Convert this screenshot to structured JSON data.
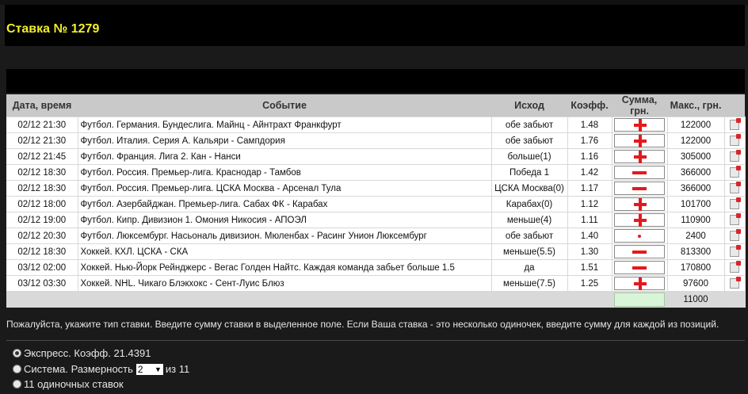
{
  "title": "Ставка № 1279",
  "table": {
    "headers": {
      "date": "Дата, время",
      "event": "Событие",
      "outcome": "Исход",
      "coef": "Коэфф.",
      "sum": "Сумма, грн.",
      "max": "Макс., грн."
    },
    "rows": [
      {
        "date": "02/12 21:30",
        "event": "Футбол. Германия. Бундеслига. Майнц - Айнтрахт Франкфурт",
        "outcome": "обе забьют",
        "coef": "1.48",
        "mark": "plus",
        "max": "122000"
      },
      {
        "date": "02/12 21:30",
        "event": "Футбол. Италия. Серия А. Кальяри - Сампдория",
        "outcome": "обе забьют",
        "coef": "1.76",
        "mark": "plus",
        "max": "122000"
      },
      {
        "date": "02/12 21:45",
        "event": "Футбол. Франция. Лига 2. Кан - Нанси",
        "outcome": "больше(1)",
        "coef": "1.16",
        "mark": "plus",
        "max": "305000"
      },
      {
        "date": "02/12 18:30",
        "event": "Футбол. Россия. Премьер-лига. Краснодар - Тамбов",
        "outcome": "Победа 1",
        "coef": "1.42",
        "mark": "minus",
        "max": "366000"
      },
      {
        "date": "02/12 18:30",
        "event": "Футбол. Россия. Премьер-лига. ЦСКА Москва - Арсенал Тула",
        "outcome": "ЦСКА Москва(0)",
        "coef": "1.17",
        "mark": "minus",
        "max": "366000"
      },
      {
        "date": "02/12 18:00",
        "event": "Футбол. Азербайджан. Премьер-лига. Сабах ФК - Карабах",
        "outcome": "Карабах(0)",
        "coef": "1.12",
        "mark": "plus",
        "max": "101700"
      },
      {
        "date": "02/12 19:00",
        "event": "Футбол. Кипр. Дивизион 1. Омония Никосия - АПОЭЛ",
        "outcome": "меньше(4)",
        "coef": "1.11",
        "mark": "plus",
        "max": "110900"
      },
      {
        "date": "02/12 20:30",
        "event": "Футбол. Люксембург. Насьональ дивизион. Мюленбах - Расинг Унион Люксембург",
        "outcome": "обе забьют",
        "coef": "1.40",
        "mark": "dot",
        "max": "2400"
      },
      {
        "date": "02/12 18:30",
        "event": "Хоккей. КХЛ. ЦСКА - СКА",
        "outcome": "меньше(5.5)",
        "coef": "1.30",
        "mark": "minus",
        "max": "813300"
      },
      {
        "date": "03/12 02:00",
        "event": "Хоккей. Нью-Йорк Рейнджерс - Вегас Голден Найтс. Каждая команда забьет больше 1.5",
        "outcome": "да",
        "coef": "1.51",
        "mark": "minus",
        "max": "170800"
      },
      {
        "date": "03/12 03:30",
        "event": "Хоккей. NHL. Чикаго Блэкхокс - Сент-Луис Блюз",
        "outcome": "меньше(7.5)",
        "coef": "1.25",
        "mark": "plus",
        "max": "97600"
      }
    ],
    "total_max": "11000"
  },
  "hint": "Пожалуйста, укажите тип ставки. Введите сумму ставки в выделенное поле. Если Ваша ставка - это несколько одиночек, введите сумму для каждой из позиций.",
  "options": {
    "express_label": "Экспресс. Коэфф. 21.4391",
    "system_label": "Система. Размерность",
    "system_value": "2",
    "system_of": "из 11",
    "singles_label": "11 одиночных ставок"
  },
  "colors": {
    "title": "#f2ee2a",
    "mark": "#e4191e",
    "total_input": "#d8f5d8"
  },
  "icons": {
    "delete": "delete-icon",
    "arrow": "chevron-down-icon"
  }
}
